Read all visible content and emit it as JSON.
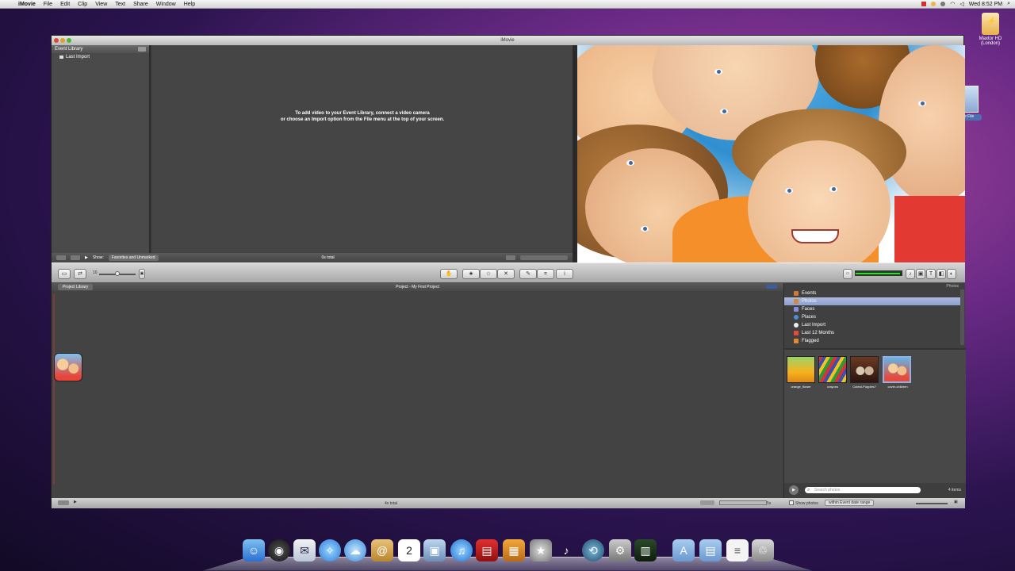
{
  "menubar": {
    "apple": "",
    "items": [
      "iMovie",
      "File",
      "Edit",
      "Clip",
      "View",
      "Text",
      "Share",
      "Window",
      "Help"
    ],
    "clock": "Wed 8:52 PM"
  },
  "desktop": {
    "disk_label_1": "Maxtor HD",
    "disk_label_2": "(London)",
    "peek_label": "e File"
  },
  "window": {
    "title": "iMovie",
    "event_library": {
      "header": "Event Library",
      "items": [
        "Last Import"
      ]
    },
    "event_browser": {
      "message_line1": "To add video to your Event Library, connect a video camera",
      "message_line2": "or choose an Import option from the File menu at the top of your screen."
    },
    "event_bar": {
      "show_label": "Show:",
      "show_value": "Favorites and Unmarked",
      "total": "0s total"
    },
    "toolbar": {
      "zoom_value": "10",
      "info_icon": "i"
    },
    "project": {
      "library_tab": "Project Library",
      "title": "Project - My First Project",
      "total": "4s total"
    },
    "photos": {
      "caption": "Photos",
      "sources": [
        "Events",
        "Photos",
        "Faces",
        "Places",
        "Last Import",
        "Last 12 Months",
        "Flagged"
      ],
      "selected_source": "Photos",
      "thumbnails": [
        {
          "label": "orange_flower",
          "color_a": "#f7b21b",
          "color_b": "#7bbf3a"
        },
        {
          "label": "crayons",
          "color_a": "#3a4fb0",
          "color_b": "#d83232"
        },
        {
          "label": "Cutest-Puppies?",
          "color_a": "#5a3322",
          "color_b": "#d8d1c4"
        },
        {
          "label": "cover-children",
          "color_a": "#62b5ea",
          "color_b": "#e84a3a"
        }
      ],
      "search_placeholder": "Search photos",
      "count": "4 items"
    },
    "bottom_bar": {
      "show_photos": "Show photos",
      "date_range": "within Event date range",
      "seconds": "5s"
    }
  },
  "dock": {
    "icons": [
      "finder-icon",
      "dashboard-icon",
      "mail-icon",
      "safari-icon",
      "ichat-icon",
      "address-book-icon",
      "ical-icon",
      "iphoto-icon",
      "itunes-icon",
      "photo-booth-icon",
      "iphoto-2-icon",
      "imovie-icon",
      "garageband-icon",
      "time-machine-icon",
      "system-preferences-icon",
      "activity-icon",
      "applications-folder-icon",
      "documents-folder-icon",
      "file-icon",
      "trash-icon"
    ]
  },
  "colors": {
    "selection": "#8ea1cf",
    "meter_green": "#3fcf3f"
  }
}
